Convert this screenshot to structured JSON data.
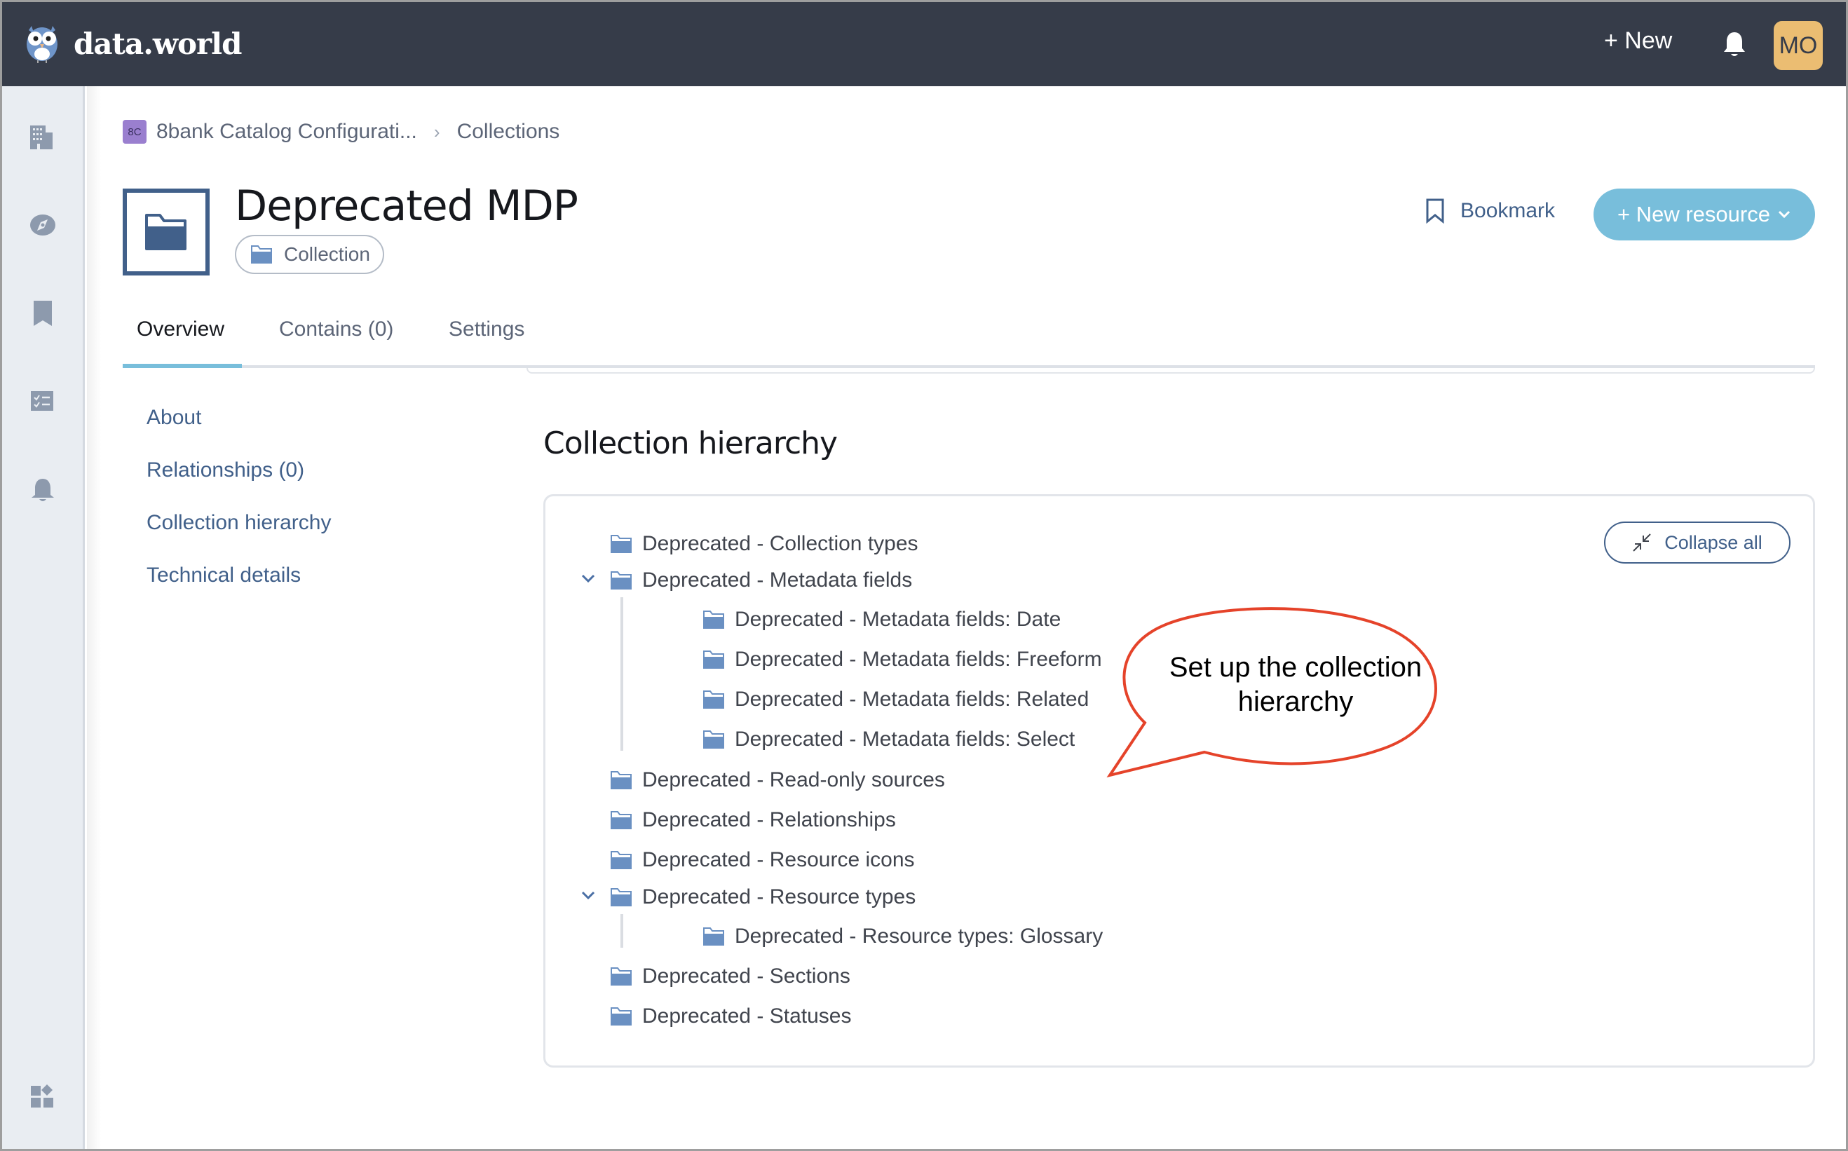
{
  "app": {
    "brand": "data.world",
    "new_label": "+ New",
    "user_initials": "MO",
    "colors": {
      "topbar": "#363c49",
      "accent": "#78bedb",
      "link": "#41608a",
      "avatar_bg": "#ebbd72",
      "callout_stroke": "#e5432a"
    }
  },
  "rail": {
    "items": [
      {
        "icon": "building-icon",
        "label": "Organizations"
      },
      {
        "icon": "compass-icon",
        "label": "Explore"
      },
      {
        "icon": "bookmark-icon",
        "label": "Bookmarks"
      },
      {
        "icon": "checklist-icon",
        "label": "Tasks"
      },
      {
        "icon": "bell-icon",
        "label": "Notifications"
      },
      {
        "icon": "apps-icon",
        "label": "Apps"
      }
    ]
  },
  "breadcrumb": {
    "org_badge": "8C",
    "org_name": "8bank Catalog Configurati...",
    "separator": "›",
    "current": "Collections"
  },
  "resource": {
    "title": "Deprecated MDP",
    "type_label": "Collection",
    "bookmark_label": "Bookmark",
    "new_resource_label": "+ New resource"
  },
  "tabs": [
    {
      "label": "Overview",
      "active": true
    },
    {
      "label": "Contains (0)",
      "active": false
    },
    {
      "label": "Settings",
      "active": false
    }
  ],
  "sidenav": [
    {
      "label": "About"
    },
    {
      "label": "Relationships (0)"
    },
    {
      "label": "Collection hierarchy"
    },
    {
      "label": "Technical details"
    }
  ],
  "hierarchy": {
    "title": "Collection hierarchy",
    "collapse_all_label": "Collapse all",
    "nodes": [
      {
        "label": "Deprecated - Collection types",
        "level": 0,
        "expanded": false,
        "has_children": false
      },
      {
        "label": "Deprecated - Metadata fields",
        "level": 0,
        "expanded": true,
        "has_children": true
      },
      {
        "label": "Deprecated - Metadata fields: Date",
        "level": 1
      },
      {
        "label": "Deprecated - Metadata fields: Freeform",
        "level": 1
      },
      {
        "label": "Deprecated - Metadata fields: Related",
        "level": 1
      },
      {
        "label": "Deprecated - Metadata fields: Select",
        "level": 1
      },
      {
        "label": "Deprecated - Read-only sources",
        "level": 0,
        "expanded": false,
        "has_children": false
      },
      {
        "label": "Deprecated - Relationships",
        "level": 0,
        "expanded": false,
        "has_children": false
      },
      {
        "label": "Deprecated - Resource icons",
        "level": 0,
        "expanded": false,
        "has_children": false
      },
      {
        "label": "Deprecated - Resource types",
        "level": 0,
        "expanded": true,
        "has_children": true
      },
      {
        "label": "Deprecated - Resource types: Glossary",
        "level": 1
      },
      {
        "label": "Deprecated - Sections",
        "level": 0,
        "expanded": false,
        "has_children": false
      },
      {
        "label": "Deprecated - Statuses",
        "level": 0,
        "expanded": false,
        "has_children": false
      }
    ]
  },
  "annotation": {
    "callout_text_line1": "Set up the collection",
    "callout_text_line2": "hierarchy"
  }
}
